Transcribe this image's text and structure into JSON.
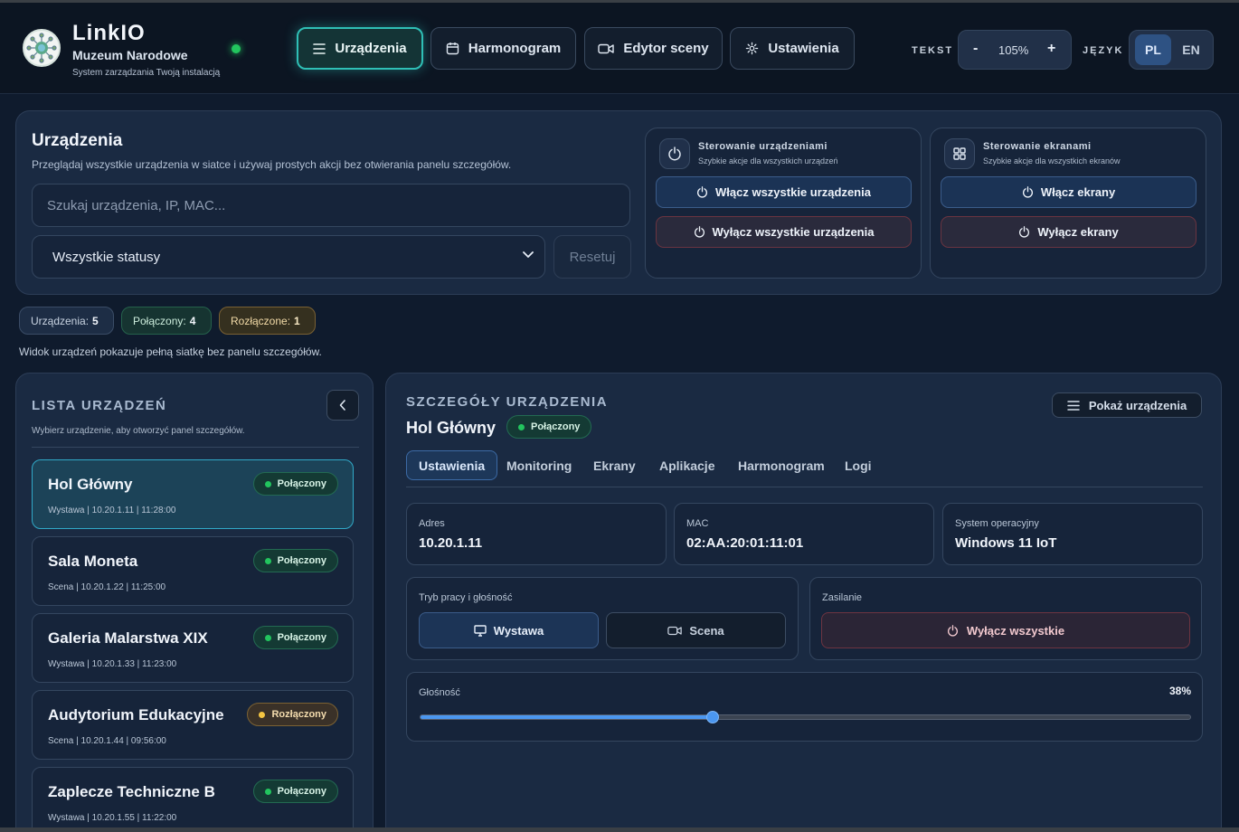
{
  "header": {
    "brand": "LinkIO",
    "org": "Muzeum Narodowe",
    "tagline": "System zarządzania Twoją instalacją",
    "nav": [
      {
        "label": "Urządzenia",
        "icon": "menu-icon",
        "active": true
      },
      {
        "label": "Harmonogram",
        "icon": "calendar-icon",
        "active": false
      },
      {
        "label": "Edytor sceny",
        "icon": "video-icon",
        "active": false
      },
      {
        "label": "Ustawienia",
        "icon": "gear-icon",
        "active": false
      }
    ],
    "text_label": "TEKST",
    "zoom_minus": "-",
    "zoom_value": "105%",
    "zoom_plus": "+",
    "lang_label": "JĘZYK",
    "langs": [
      "PL",
      "EN"
    ],
    "active_lang": "PL"
  },
  "devices_panel": {
    "title": "Urządzenia",
    "description": "Przeglądaj wszystkie urządzenia w siatce i używaj prostych akcji bez otwierania panelu szczegółów.",
    "search_placeholder": "Szukaj urządzenia, IP, MAC...",
    "status_filter": "Wszystkie statusy",
    "reset_label": "Resetuj",
    "device_control": {
      "title": "Sterowanie urządzeniami",
      "subtitle": "Szybkie akcje dla wszystkich urządzeń",
      "on_label": "Włącz wszystkie urządzenia",
      "off_label": "Wyłącz wszystkie urządzenia"
    },
    "screen_control": {
      "title": "Sterowanie ekranami",
      "subtitle": "Szybkie akcje dla wszystkich ekranów",
      "on_label": "Włącz ekrany",
      "off_label": "Wyłącz ekrany"
    }
  },
  "summary": {
    "total_label": "Urządzenia:",
    "total": "5",
    "connected_label": "Połączony:",
    "connected": "4",
    "disconnected_label": "Rozłączone:",
    "disconnected": "1",
    "note": "Widok urządzeń pokazuje pełną siatkę bez panelu szczegółów."
  },
  "device_list": {
    "title": "LISTA URZĄDZEŃ",
    "subtitle": "Wybierz urządzenie, aby otworzyć panel szczegółów.",
    "items": [
      {
        "name": "Hol Główny",
        "meta": "Wystawa | 10.20.1.11 | 11:28:00",
        "status": "Połączony",
        "state": "ok",
        "selected": true
      },
      {
        "name": "Sala Moneta",
        "meta": "Scena | 10.20.1.22 | 11:25:00",
        "status": "Połączony",
        "state": "ok",
        "selected": false
      },
      {
        "name": "Galeria Malarstwa XIX",
        "meta": "Wystawa | 10.20.1.33 | 11:23:00",
        "status": "Połączony",
        "state": "ok",
        "selected": false
      },
      {
        "name": "Audytorium Edukacyjne",
        "meta": "Scena | 10.20.1.44 | 09:56:00",
        "status": "Rozłączony",
        "state": "bad",
        "selected": false
      },
      {
        "name": "Zaplecze Techniczne B",
        "meta": "Wystawa | 10.20.1.55 | 11:22:00",
        "status": "Połączony",
        "state": "ok",
        "selected": false
      }
    ]
  },
  "details": {
    "title": "SZCZEGÓŁY URZĄDZENIA",
    "device_name": "Hol Główny",
    "status": "Połączony",
    "show_devices_label": "Pokaż urządzenia",
    "tabs": [
      "Ustawienia",
      "Monitoring",
      "Ekrany",
      "Aplikacje",
      "Harmonogram",
      "Logi"
    ],
    "active_tab": "Ustawienia",
    "address_label": "Adres",
    "address": "10.20.1.11",
    "mac_label": "MAC",
    "mac": "02:AA:20:01:11:01",
    "os_label": "System operacyjny",
    "os": "Windows 11 IoT",
    "mode_label": "Tryb pracy i głośność",
    "mode_exhibition": "Wystawa",
    "mode_stage": "Scena",
    "active_mode": "Wystawa",
    "power_label": "Zasilanie",
    "power_off_label": "Wyłącz wszystkie",
    "volume_label": "Głośność",
    "volume_text": "38%",
    "volume": 38
  },
  "colors": {
    "accent": "#2fbfb6",
    "connected": "#22c55e",
    "disconnected": "#f4c542",
    "slider": "#4b97f0",
    "danger_border": "#6e3441"
  }
}
